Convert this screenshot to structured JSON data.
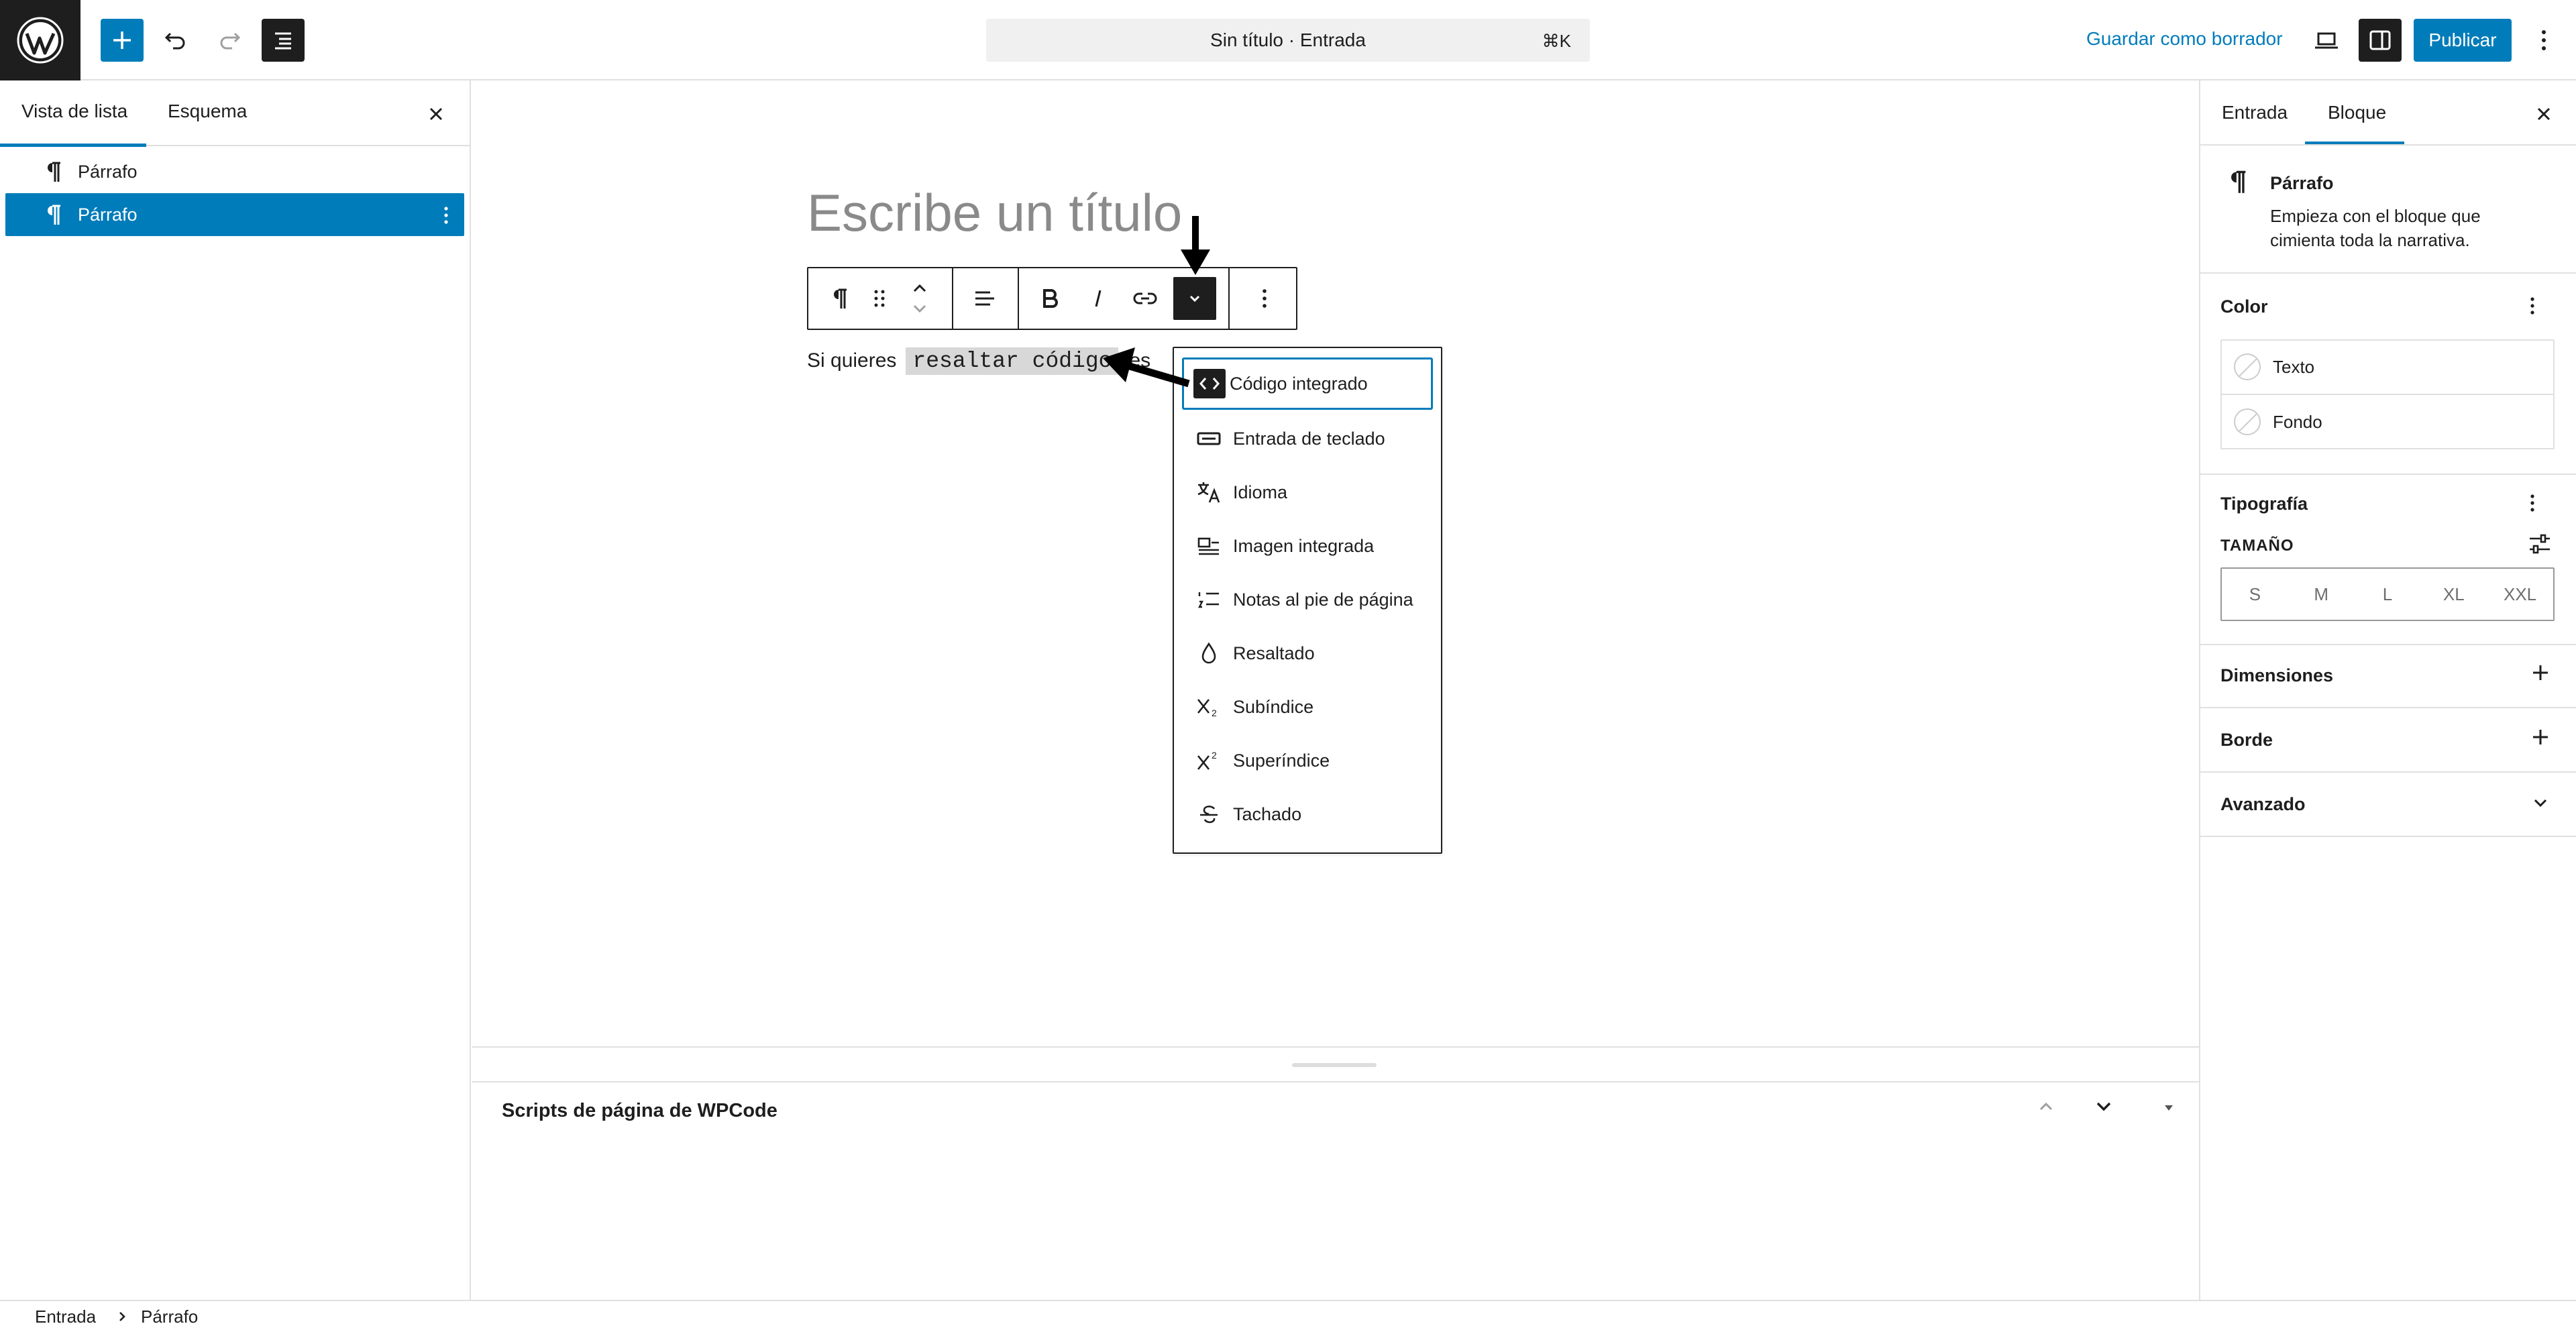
{
  "topbar": {
    "document_title": "Sin título · Entrada",
    "shortcut": "⌘K",
    "save_draft": "Guardar como borrador",
    "publish": "Publicar"
  },
  "left_sidebar": {
    "tabs": [
      "Vista de lista",
      "Esquema"
    ],
    "active_tab": "Vista de lista",
    "items": [
      {
        "label": "Párrafo"
      },
      {
        "label": "Párrafo",
        "selected": true
      }
    ]
  },
  "editor": {
    "title_placeholder": "Escribe un título",
    "paragraph_prefix": "Si quieres",
    "paragraph_code": "resaltar código",
    "paragraph_suffix": "es"
  },
  "format_menu": {
    "items": [
      {
        "label": "Código integrado",
        "icon": "code-icon",
        "active": true
      },
      {
        "label": "Entrada de teclado",
        "icon": "keyboard-icon"
      },
      {
        "label": "Idioma",
        "icon": "language-icon"
      },
      {
        "label": "Imagen integrada",
        "icon": "inline-image-icon"
      },
      {
        "label": "Notas al pie de página",
        "icon": "footnotes-icon"
      },
      {
        "label": "Resaltado",
        "icon": "highlight-drop-icon"
      },
      {
        "label": "Subíndice",
        "icon": "subscript-icon"
      },
      {
        "label": "Superíndice",
        "icon": "superscript-icon"
      },
      {
        "label": "Tachado",
        "icon": "strikethrough-icon"
      }
    ]
  },
  "meta_box": {
    "title": "Scripts de página de WPCode"
  },
  "right_sidebar": {
    "tabs": [
      "Entrada",
      "Bloque"
    ],
    "active_tab": "Bloque",
    "block_card": {
      "title": "Párrafo",
      "description": "Empieza con el bloque que cimienta toda la narrativa."
    },
    "color": {
      "heading": "Color",
      "items": [
        "Texto",
        "Fondo"
      ]
    },
    "typography": {
      "heading": "Tipografía",
      "size_label": "TAMAÑO",
      "sizes": [
        "S",
        "M",
        "L",
        "XL",
        "XXL"
      ]
    },
    "panels": [
      "Dimensiones",
      "Borde",
      "Avanzado"
    ]
  },
  "breadcrumb": [
    "Entrada",
    "Párrafo"
  ],
  "colors": {
    "accent": "#007cba",
    "dark": "#1e1e1e",
    "border": "#e0e0e0"
  }
}
